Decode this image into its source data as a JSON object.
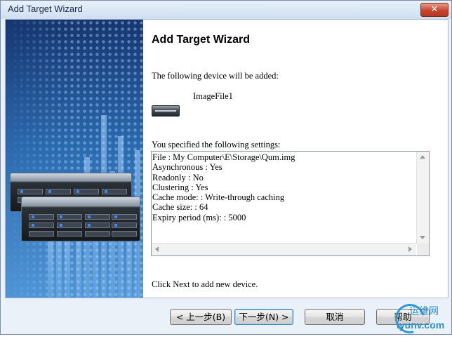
{
  "window": {
    "title": "Add Target Wizard",
    "close_glyph": "✕"
  },
  "banner": {
    "image": "server-rack-illustration",
    "colors": {
      "top": "#16356f",
      "bottom": "#4f95d6"
    }
  },
  "content": {
    "heading": "Add Target Wizard",
    "intro": "The following device will be added:",
    "device": {
      "icon": "server-device-icon",
      "name": "ImageFile1"
    },
    "settings_label": "You specified the following settings:",
    "settings": [
      "File : My Computer\\E\\Storage\\Qum.img",
      "Asynchronous : Yes",
      "Readonly : No",
      "Clustering : Yes",
      "Cache mode: : Write-through caching",
      "Cache size: : 64",
      "Expiry period (ms): : 5000"
    ],
    "footer_hint": "Click Next to add new device."
  },
  "buttons": {
    "back": "< 上一步(B)",
    "next": "下一步(N) >",
    "cancel": "取消",
    "help": "帮助"
  },
  "watermark": {
    "text_cn": "运维网",
    "text_url": "iyunv.com"
  }
}
